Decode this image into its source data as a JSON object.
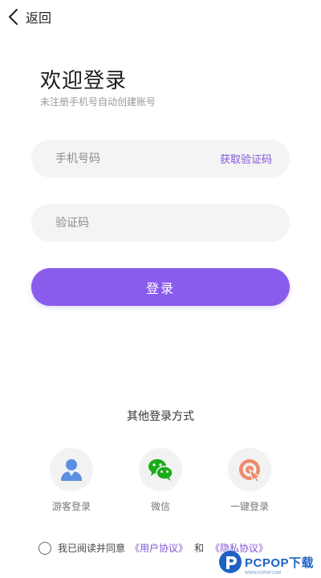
{
  "nav": {
    "back_label": "返回"
  },
  "header": {
    "title": "欢迎登录",
    "subtitle": "未注册手机号自动创建账号"
  },
  "form": {
    "phone_placeholder": "手机号码",
    "get_code_label": "获取验证码",
    "code_placeholder": "验证码",
    "login_label": "登录"
  },
  "other_login": {
    "title": "其他登录方式",
    "options": [
      {
        "label": "游客登录",
        "icon": "guest-user-icon"
      },
      {
        "label": "微信",
        "icon": "wechat-icon"
      },
      {
        "label": "一键登录",
        "icon": "one-key-login-icon"
      }
    ]
  },
  "agreement": {
    "prefix": "我已阅读并同意",
    "user_agreement": "《用户协议》",
    "and": "和",
    "privacy_policy": "《隐私协议》"
  },
  "watermark": {
    "text": "PCPOP下载",
    "sub": "WWW.PCPOP.COM"
  },
  "colors": {
    "accent": "#8a5cec",
    "link": "#8158d6",
    "field_bg": "#f4f4f5",
    "wechat_green": "#1aad19",
    "guest_blue": "#5b8fe0",
    "onekey_orange": "#f08a6a"
  }
}
